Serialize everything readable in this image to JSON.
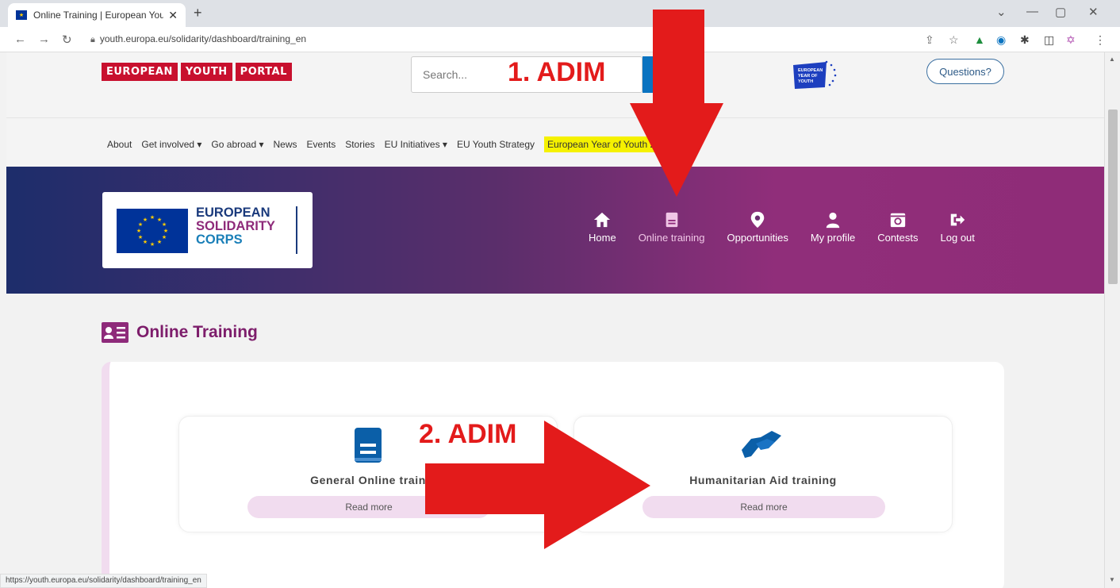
{
  "browser": {
    "tab_title": "Online Training | European Youth",
    "tab_close": "✕",
    "new_tab": "+",
    "url": "youth.europa.eu/solidarity/dashboard/training_en",
    "status_url": "https://youth.europa.eu/solidarity/dashboard/training_en"
  },
  "portal": {
    "logo_words": [
      "EUROPEAN",
      "YOUTH",
      "PORTAL"
    ],
    "search_placeholder": "Search...",
    "eyy_logo_text": "EUROPEAN YEAR OF YOUTH",
    "questions_label": "Questions?",
    "topnav": [
      {
        "label": "About"
      },
      {
        "label": "Get involved ▾"
      },
      {
        "label": "Go abroad ▾"
      },
      {
        "label": "News"
      },
      {
        "label": "Events"
      },
      {
        "label": "Stories"
      },
      {
        "label": "EU Initiatives ▾"
      },
      {
        "label": "EU Youth Strategy"
      }
    ],
    "highlight_nav": "European Year of Youth 2022"
  },
  "esc": {
    "line1": "EUROPEAN",
    "line2": "SOLIDARITY",
    "line3": "CORPS"
  },
  "mainnav": [
    {
      "label": "Home",
      "icon": "home-icon"
    },
    {
      "label": "Online training",
      "icon": "book-icon",
      "active": true
    },
    {
      "label": "Opportunities",
      "icon": "map-pin-icon"
    },
    {
      "label": "My profile",
      "icon": "user-icon"
    },
    {
      "label": "Contests",
      "icon": "camera-icon"
    },
    {
      "label": "Log out",
      "icon": "logout-icon"
    }
  ],
  "page_title": "Online Training",
  "cards": [
    {
      "title": "General Online training",
      "visible_title": "General Online train",
      "button": "Read more",
      "icon": "book-icon"
    },
    {
      "title": "Humanitarian Aid training",
      "button": "Read more",
      "icon": "handshake-icon"
    }
  ],
  "annotations": {
    "step1": "1. ADIM",
    "step2": "2. ADIM"
  },
  "colors": {
    "arrow": "#e31b1b",
    "esc_purple": "#8e2a7a",
    "banner_start": "#1d2d6b",
    "banner_end": "#902e7a",
    "portal_red": "#c8102e"
  }
}
